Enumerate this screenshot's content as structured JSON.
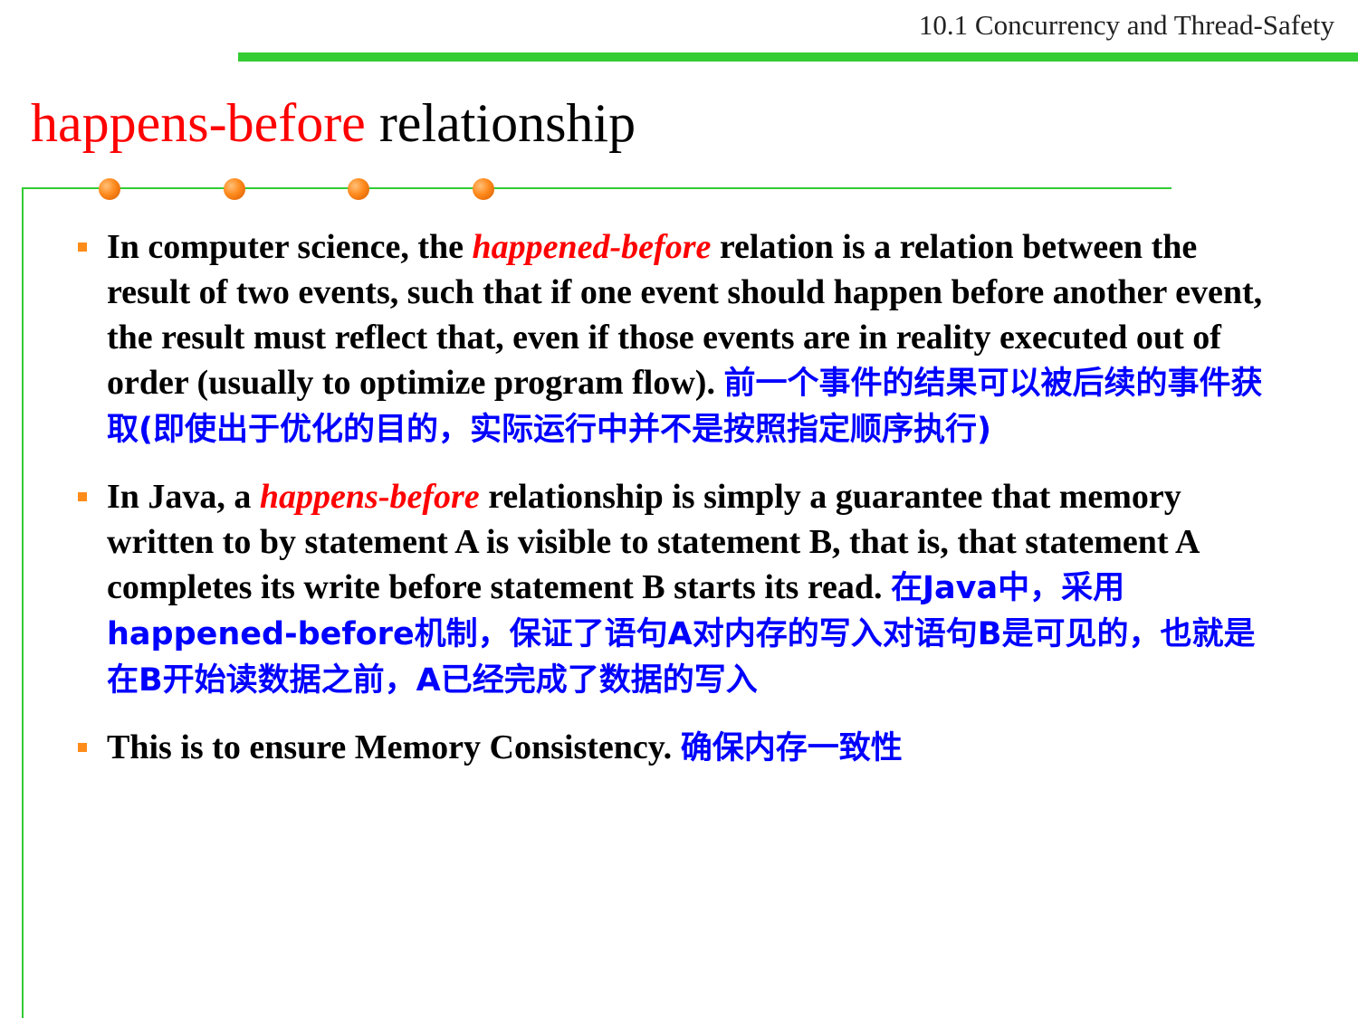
{
  "header": {
    "section_title": "10.1 Concurrency and Thread-Safety"
  },
  "slide": {
    "title_accent": "happens-before",
    "title_rest": " relationship"
  },
  "bullets": [
    {
      "before": "In computer science, the ",
      "emphasis": "happened-before",
      "after": " relation is a relation between the result of two events, such that if one event should happen before another event, the result must reflect that, even if those events are in reality executed out of order (usually to optimize program flow). ",
      "zh": "前一个事件的结果可以被后续的事件获取(即使出于优化的目的，实际运行中并不是按照指定顺序执行)"
    },
    {
      "before": "In Java, a ",
      "emphasis": "happens-before",
      "after": " relationship is simply a guarantee that memory written to by statement A is visible to statement B, that is, that statement A completes its write before statement B starts its read.   ",
      "zh": "在Java中，采用happened-before机制，保证了语句A对内存的写入对语句B是可见的，也就是在B开始读数据之前，A已经完成了数据的写入"
    },
    {
      "before": "This is to ensure Memory Consistency. ",
      "emphasis": "",
      "after": "",
      "zh": "确保内存一致性"
    }
  ],
  "colors": {
    "accent_red": "#ff0000",
    "chinese_blue": "#0000ff",
    "rule_green": "#33cc33",
    "bullet_orange": "#ff8c1a"
  },
  "icons": [
    "orange-dot-icon",
    "square-bullet-icon"
  ]
}
